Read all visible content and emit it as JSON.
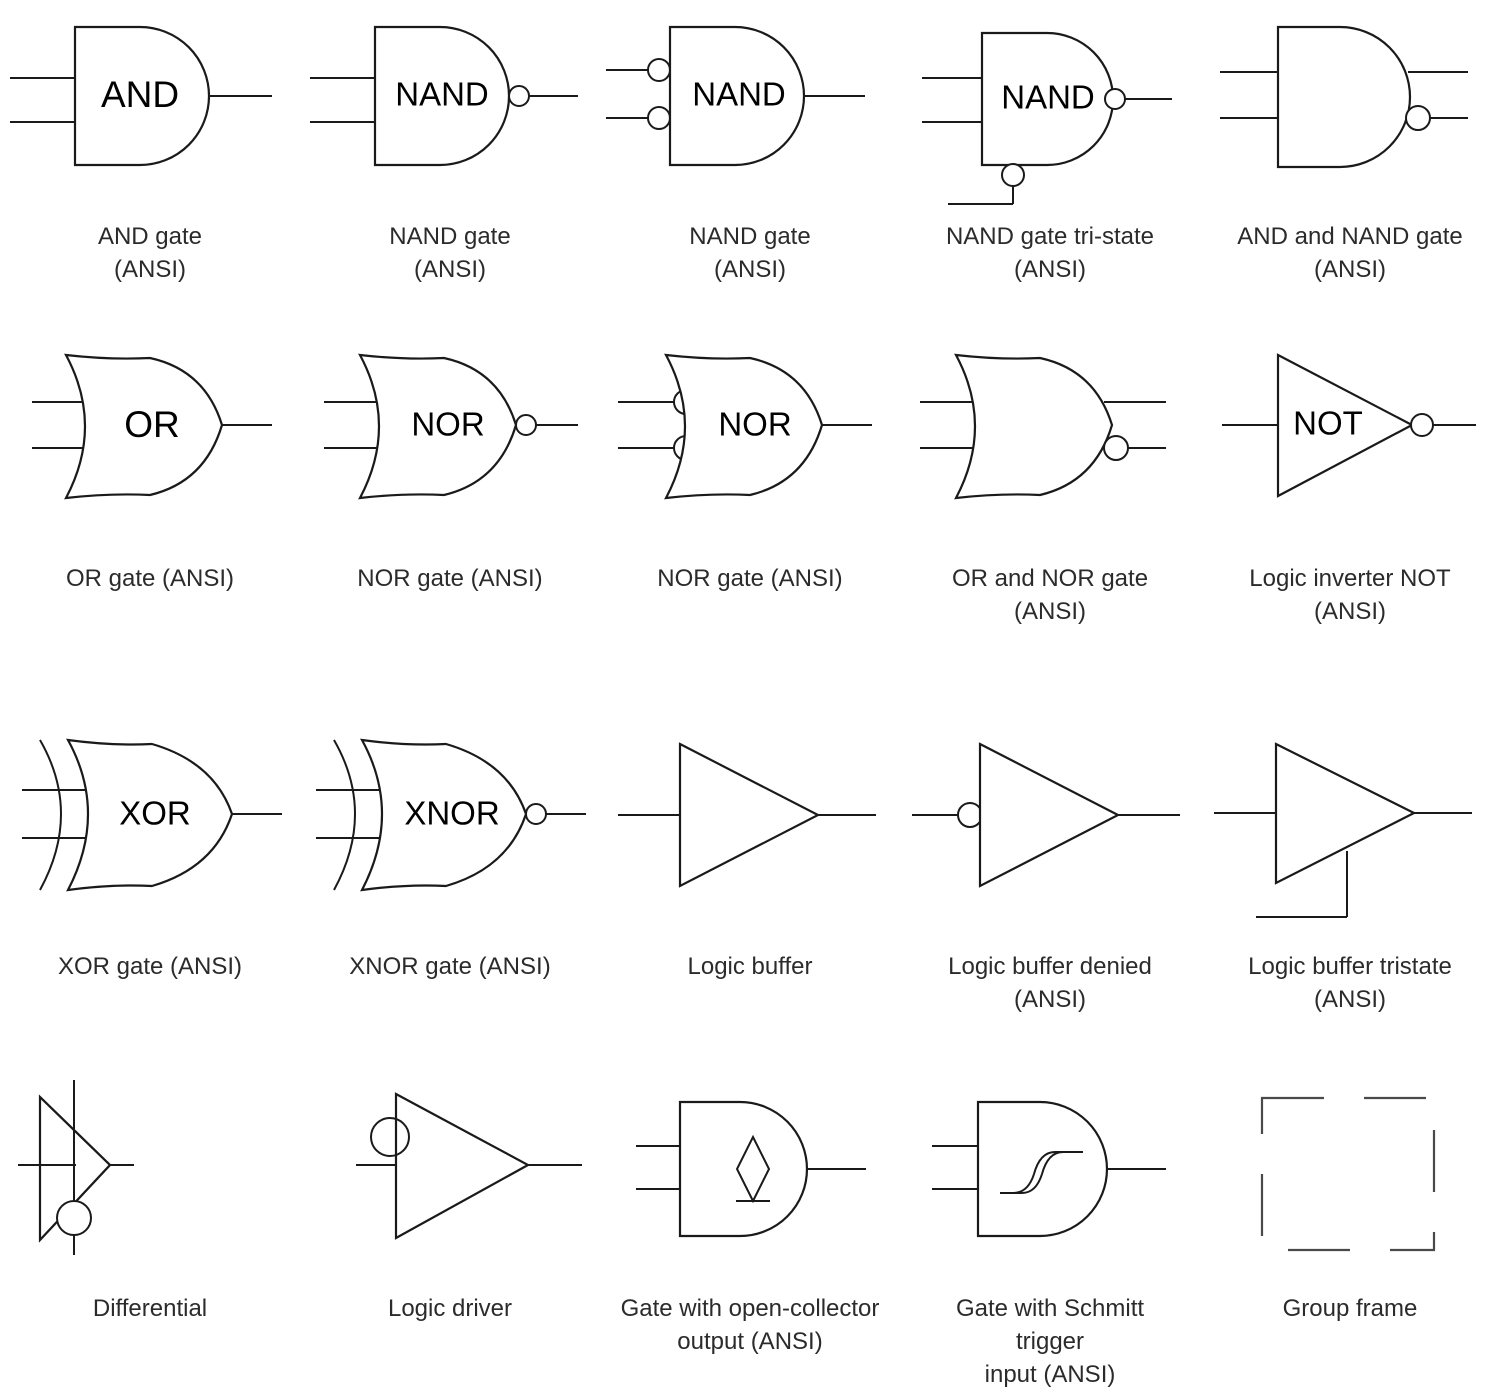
{
  "page": {
    "title": "Logic gate symbols — ANSI",
    "background": "#ffffff",
    "stroke_color": "#1a1a1a",
    "caption_color": "#2b2b2b",
    "columns": 5,
    "rows": 4
  },
  "symbols": [
    {
      "id": "and-gate-ansi",
      "caption": "AND gate\n(ANSI)",
      "gate_text": "AND",
      "shape": "and",
      "inputs": 2,
      "input_bubbles": false,
      "output_bubble": false
    },
    {
      "id": "nand-gate-ansi",
      "caption": "NAND gate\n(ANSI)",
      "gate_text": "NAND",
      "shape": "and",
      "inputs": 2,
      "input_bubbles": false,
      "output_bubble": true
    },
    {
      "id": "nand-gate-inv-in-ansi",
      "caption": "NAND gate\n(ANSI)",
      "gate_text": "NAND",
      "shape": "and",
      "inputs": 2,
      "input_bubbles": true,
      "output_bubble": false
    },
    {
      "id": "nand-gate-tristate-ansi",
      "caption": "NAND gate tri-state\n(ANSI)",
      "gate_text": "NAND",
      "shape": "and",
      "inputs": 2,
      "input_bubbles": false,
      "output_bubble": true,
      "enable_bubble": true
    },
    {
      "id": "and-and-nand-gate-ansi",
      "caption": "AND and NAND gate\n(ANSI)",
      "gate_text": "",
      "shape": "and",
      "inputs": 2,
      "input_bubbles": false,
      "outputs": 2
    },
    {
      "id": "or-gate-ansi",
      "caption": "OR gate (ANSI)",
      "gate_text": "OR",
      "shape": "or",
      "inputs": 2,
      "input_bubbles": false,
      "output_bubble": false
    },
    {
      "id": "nor-gate-ansi",
      "caption": "NOR gate (ANSI)",
      "gate_text": "NOR",
      "shape": "or",
      "inputs": 2,
      "input_bubbles": false,
      "output_bubble": true
    },
    {
      "id": "nor-gate-inv-in-ansi",
      "caption": "NOR gate (ANSI)",
      "gate_text": "NOR",
      "shape": "or",
      "inputs": 2,
      "input_bubbles": true,
      "output_bubble": false
    },
    {
      "id": "or-and-nor-gate-ansi",
      "caption": "OR and NOR gate\n(ANSI)",
      "gate_text": "",
      "shape": "or",
      "inputs": 2,
      "input_bubbles": false,
      "outputs": 2
    },
    {
      "id": "logic-inverter-not-ansi",
      "caption": "Logic inverter NOT\n(ANSI)",
      "gate_text": "NOT",
      "shape": "triangle",
      "inputs": 1,
      "input_bubbles": false,
      "output_bubble": true
    },
    {
      "id": "xor-gate-ansi",
      "caption": "XOR gate (ANSI)",
      "gate_text": "XOR",
      "shape": "xor",
      "inputs": 2,
      "input_bubbles": false,
      "output_bubble": false
    },
    {
      "id": "xnor-gate-ansi",
      "caption": "XNOR gate (ANSI)",
      "gate_text": "XNOR",
      "shape": "xor",
      "inputs": 2,
      "input_bubbles": false,
      "output_bubble": true
    },
    {
      "id": "logic-buffer",
      "caption": "Logic buffer",
      "gate_text": "",
      "shape": "triangle",
      "inputs": 1,
      "input_bubbles": false,
      "output_bubble": false
    },
    {
      "id": "logic-buffer-denied-ansi",
      "caption": "Logic buffer denied\n(ANSI)",
      "gate_text": "",
      "shape": "triangle",
      "inputs": 1,
      "input_bubbles": true,
      "output_bubble": false
    },
    {
      "id": "logic-buffer-tristate-ansi",
      "caption": "Logic buffer tristate\n(ANSI)",
      "gate_text": "",
      "shape": "triangle",
      "inputs": 1,
      "input_bubbles": false,
      "output_bubble": false,
      "enable_line": true
    },
    {
      "id": "differential",
      "caption": "Differential",
      "gate_text": "",
      "shape": "differential",
      "inputs": 1
    },
    {
      "id": "logic-driver",
      "caption": "Logic driver",
      "gate_text": "",
      "shape": "driver",
      "inputs": 1
    },
    {
      "id": "gate-open-collector-ansi",
      "caption": "Gate with open-collector\noutput (ANSI)",
      "gate_text": "",
      "shape": "and",
      "inputs": 2,
      "marker": "open-collector-diamond"
    },
    {
      "id": "gate-schmitt-trigger-ansi",
      "caption": "Gate with Schmitt\ntrigger\ninput (ANSI)",
      "gate_text": "",
      "shape": "and",
      "inputs": 2,
      "marker": "schmitt-hysteresis"
    },
    {
      "id": "group-frame",
      "caption": "Group frame",
      "gate_text": "",
      "shape": "group-frame"
    }
  ]
}
